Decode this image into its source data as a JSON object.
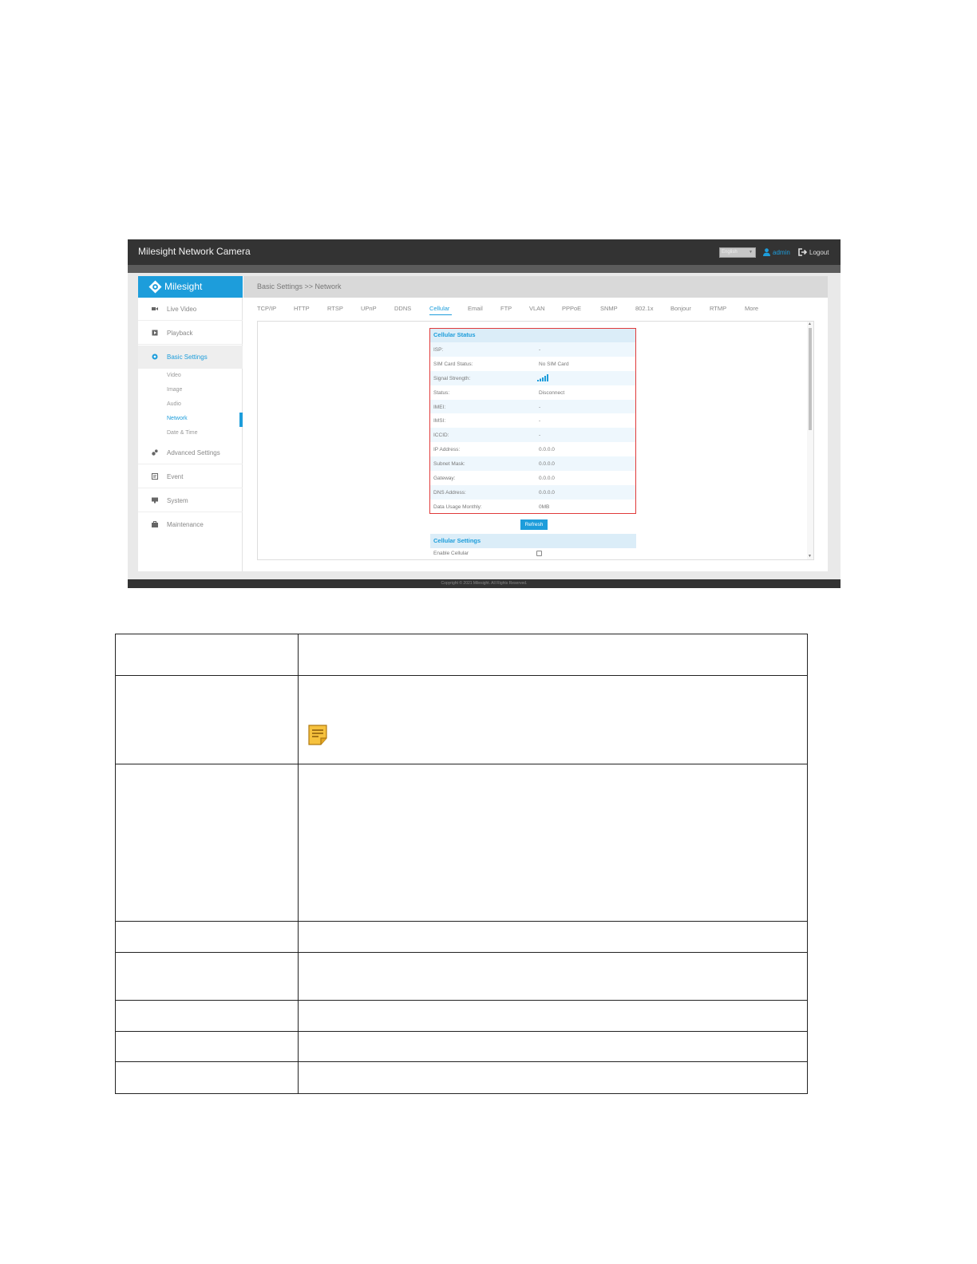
{
  "app": {
    "title": "Milesight Network Camera",
    "language": "English",
    "user": "admin",
    "logout": "Logout",
    "brand": "Milesight",
    "footer": "Copyright © 2021 Milesight. All Rights Reserved."
  },
  "colors": {
    "accent": "#1d9ddb",
    "topbar": "#333333",
    "highlight_frame": "#e03a3a"
  },
  "sidebar": {
    "items": [
      {
        "label": "Live Video",
        "icon": "video-camera-icon"
      },
      {
        "label": "Playback",
        "icon": "play-icon"
      },
      {
        "label": "Basic Settings",
        "icon": "gear-icon",
        "active": true
      },
      {
        "label": "Advanced Settings",
        "icon": "gears-icon"
      },
      {
        "label": "Event",
        "icon": "event-icon"
      },
      {
        "label": "System",
        "icon": "monitor-icon"
      },
      {
        "label": "Maintenance",
        "icon": "toolbox-icon"
      }
    ],
    "sub_items": [
      "Video",
      "Image",
      "Audio",
      "Network",
      "Date & Time"
    ],
    "active_sub": "Network"
  },
  "breadcrumb": "Basic Settings >> Network",
  "tabs": [
    "TCP/IP",
    "HTTP",
    "RTSP",
    "UPnP",
    "DDNS",
    "Cellular",
    "Email",
    "FTP",
    "VLAN",
    "PPPoE",
    "SNMP",
    "802.1x",
    "Bonjour",
    "RTMP",
    "More"
  ],
  "active_tab": "Cellular",
  "cellular_status": {
    "title": "Cellular Status",
    "rows": [
      {
        "label": "ISP:",
        "value": "-"
      },
      {
        "label": "SIM Card Status:",
        "value": "No SIM Card"
      },
      {
        "label": "Signal Strength:",
        "value": "",
        "icon": "signal-strength-icon"
      },
      {
        "label": "Status:",
        "value": "Disconnect"
      },
      {
        "label": "IMEI:",
        "value": "-"
      },
      {
        "label": "IMSI:",
        "value": "-"
      },
      {
        "label": "ICCID:",
        "value": "-"
      },
      {
        "label": "IP Address:",
        "value": "0.0.0.0"
      },
      {
        "label": "Subnet Mask:",
        "value": "0.0.0.0"
      },
      {
        "label": "Gateway:",
        "value": "0.0.0.0"
      },
      {
        "label": "DNS Address:",
        "value": "0.0.0.0"
      },
      {
        "label": "Data Usage Monthly:",
        "value": "0MB"
      }
    ]
  },
  "refresh_label": "Refresh",
  "cellular_settings": {
    "title": "Cellular Settings",
    "enable_label": "Enable Cellular",
    "enabled": false
  }
}
